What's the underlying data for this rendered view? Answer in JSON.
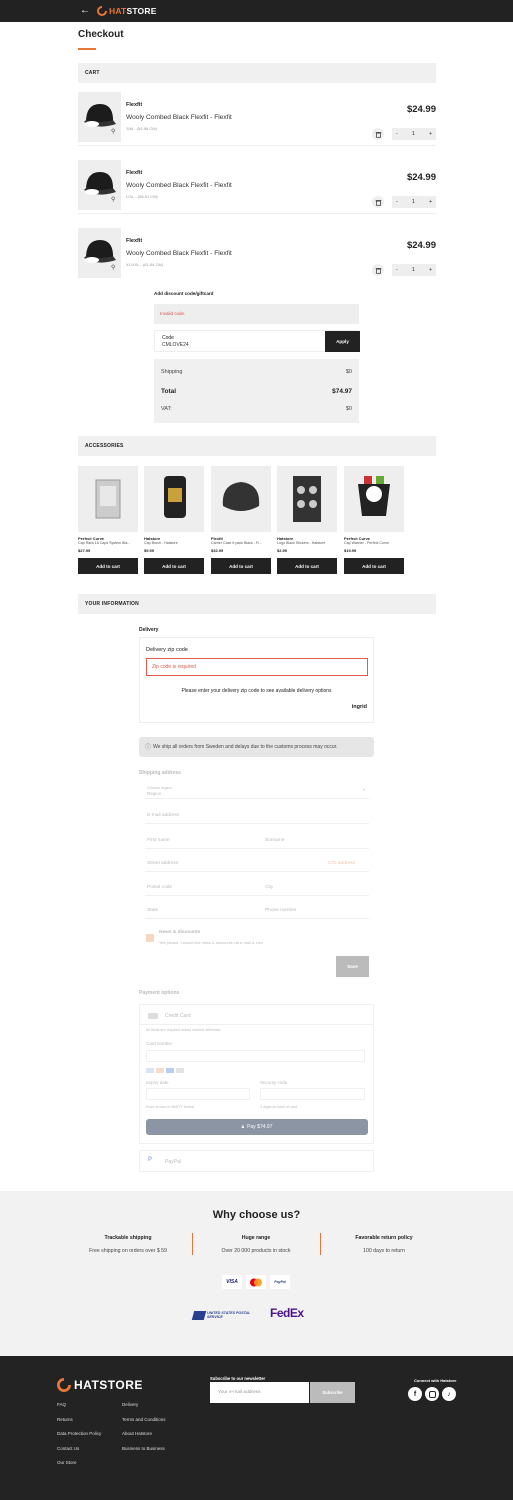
{
  "header": {
    "back_icon": "←",
    "logo_text_a": "HAT",
    "logo_text_b": "STORE"
  },
  "page": {
    "title": "Checkout"
  },
  "cart": {
    "section_label": "CART",
    "items": [
      {
        "brand": "Flexfit",
        "name": "Wooly Combed Black Flexfit - Flexfit",
        "size": "S/M - (55-58 CM)",
        "price": "$24.99",
        "qty": "1"
      },
      {
        "brand": "Flexfit",
        "name": "Wooly Combed Black Flexfit - Flexfit",
        "size": "L/XL - (58-61 CM)",
        "price": "$24.99",
        "qty": "1"
      },
      {
        "brand": "Flexfit",
        "name": "Wooly Combed Black Flexfit - Flexfit",
        "size": "XL/XXL - (61-64 CM)",
        "price": "$24.99",
        "qty": "1"
      }
    ],
    "minus": "-",
    "plus": "+"
  },
  "discount": {
    "label": "Add discount code/giftcard",
    "error": "Invalid code.",
    "code_label": "Code",
    "code_value": "CMLOVE24",
    "apply": "Apply"
  },
  "summary": {
    "shipping_label": "Shipping",
    "shipping_value": "$0",
    "total_label": "Total",
    "total_value": "$74.97",
    "vat_label": "VAT:",
    "vat_value": "$0"
  },
  "accessories": {
    "section_label": "ACCESSORIES",
    "button_label": "Add to cart",
    "items": [
      {
        "brand": "Perfect Curve",
        "name": "Cap Rack 18 Caps System Bla...",
        "price": "$27.99"
      },
      {
        "brand": "Hatstore",
        "name": "Cap Brush - Hatstore",
        "price": "$9.99"
      },
      {
        "brand": "Flexfit",
        "name": "Carrier Case 6 pack Black - Fl...",
        "price": "$32.99"
      },
      {
        "brand": "Hatstore",
        "name": "Logo Black Stickers - Hatstore",
        "price": "$2.99"
      },
      {
        "brand": "Perfect Curve",
        "name": "Cap Washer - Perfect Curve",
        "price": "$19.99"
      }
    ]
  },
  "information": {
    "section_label": "YOUR INFORMATION",
    "delivery_title": "Delivery",
    "zip_label": "Delivery zip code",
    "zip_error": "Zip code is required",
    "zip_hint": "Please enter your delivery zip code to see available delivery options",
    "powered_by": "ingrid",
    "info_text": "We ship all orders from Sweden and delays due to the customs process may occur.",
    "shipping_address_title": "Shipping address",
    "country_label": "Choose region",
    "country_value": "Region",
    "email_placeholder": "E-mail address",
    "first_name_placeholder": "First name",
    "surname_placeholder": "Surname",
    "street_placeholder": "Street address",
    "co_address": "C/O address",
    "postal_placeholder": "Postal code",
    "city_placeholder": "City",
    "state_placeholder": "State",
    "phone_placeholder": "Phone number",
    "news_title": "News & discounts",
    "news_text": "Yes please, I would like news & discounts via e-mail & sms",
    "save": "Save"
  },
  "payment": {
    "title": "Payment options",
    "credit_card": "Credit Card",
    "required_note": "All fields are required unless marked otherwise",
    "card_number_label": "Card number",
    "expiry_label": "Expiry date",
    "security_label": "Security code",
    "expiry_hint": "Front of card in MM/YY format",
    "security_hint": "3 digits on back of card",
    "pay_button": "Pay $74.97",
    "paypal": "PayPal"
  },
  "why": {
    "title": "Why choose us?",
    "columns": [
      {
        "heading": "Trackable shipping",
        "text": "Free shipping on orders over $ 59"
      },
      {
        "heading": "Huge range",
        "text": "Over 20 000 products in stock"
      },
      {
        "heading": "Favorable return policy",
        "text": "100 days to return"
      }
    ],
    "payment_logos": [
      "VISA",
      "mastercard",
      "PayPal"
    ],
    "shipping_logos": [
      "UNITED STATES POSTAL SERVICE",
      "FedEx"
    ]
  },
  "footer": {
    "logo_a": "HAT",
    "logo_b": "STORE",
    "links_col1": [
      "FAQ",
      "Returns",
      "Data Protection Policy",
      "Contact Us",
      "Our Store"
    ],
    "links_col2": [
      "Delivery",
      "Terms and Conditions",
      "About Hatstore",
      "Business to Business"
    ],
    "newsletter_label": "Subscribe to our newsletter",
    "newsletter_placeholder": "Your e-mail address",
    "newsletter_button": "Subscribe",
    "social_label": "Connect with Hatstore",
    "social_icons": [
      "facebook-icon",
      "instagram-icon",
      "tiktok-icon"
    ]
  },
  "colors": {
    "accent": "#e8753a",
    "dark": "#232323",
    "error": "#e05a4f"
  }
}
